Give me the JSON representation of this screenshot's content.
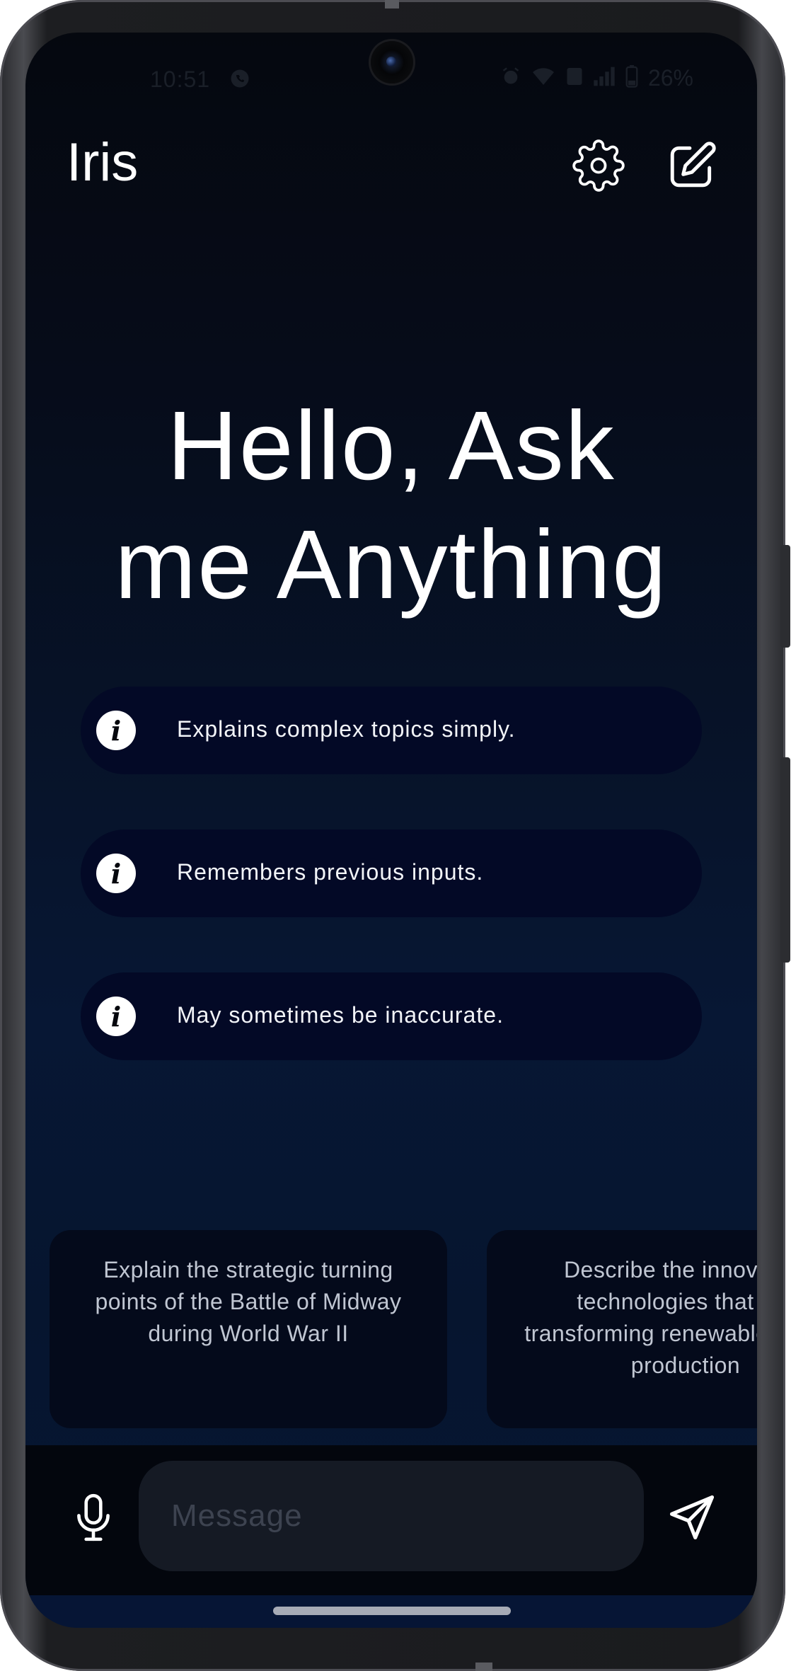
{
  "status_bar": {
    "time": "10:51",
    "battery": "26%",
    "icons": [
      "whatsapp-icon",
      "alarm-icon",
      "wifi-icon",
      "volte-icon",
      "signal-icon",
      "battery-icon"
    ]
  },
  "header": {
    "title": "Iris",
    "settings_icon": "gear-icon",
    "new_chat_icon": "edit-square-icon"
  },
  "hero": {
    "line1": "Hello, Ask",
    "line2": "me Anything"
  },
  "features": [
    {
      "icon": "info-icon",
      "text": "Explains complex topics simply."
    },
    {
      "icon": "info-icon",
      "text": "Remembers previous inputs."
    },
    {
      "icon": "info-icon",
      "text": "May sometimes be inaccurate."
    }
  ],
  "suggestions": [
    {
      "text": "Explain the strategic turning points of the Battle of Midway during World War II"
    },
    {
      "text": "Describe the innovative technologies that are transforming renewable energy production"
    }
  ],
  "composer": {
    "placeholder": "Message",
    "value": "",
    "mic_icon": "microphone-icon",
    "send_icon": "send-icon"
  },
  "colors": {
    "background_top": "#05080f",
    "background_bottom": "#071633",
    "pill": "#030926",
    "card": "#040a1b",
    "input": "#151a24",
    "text": "#ffffff"
  }
}
